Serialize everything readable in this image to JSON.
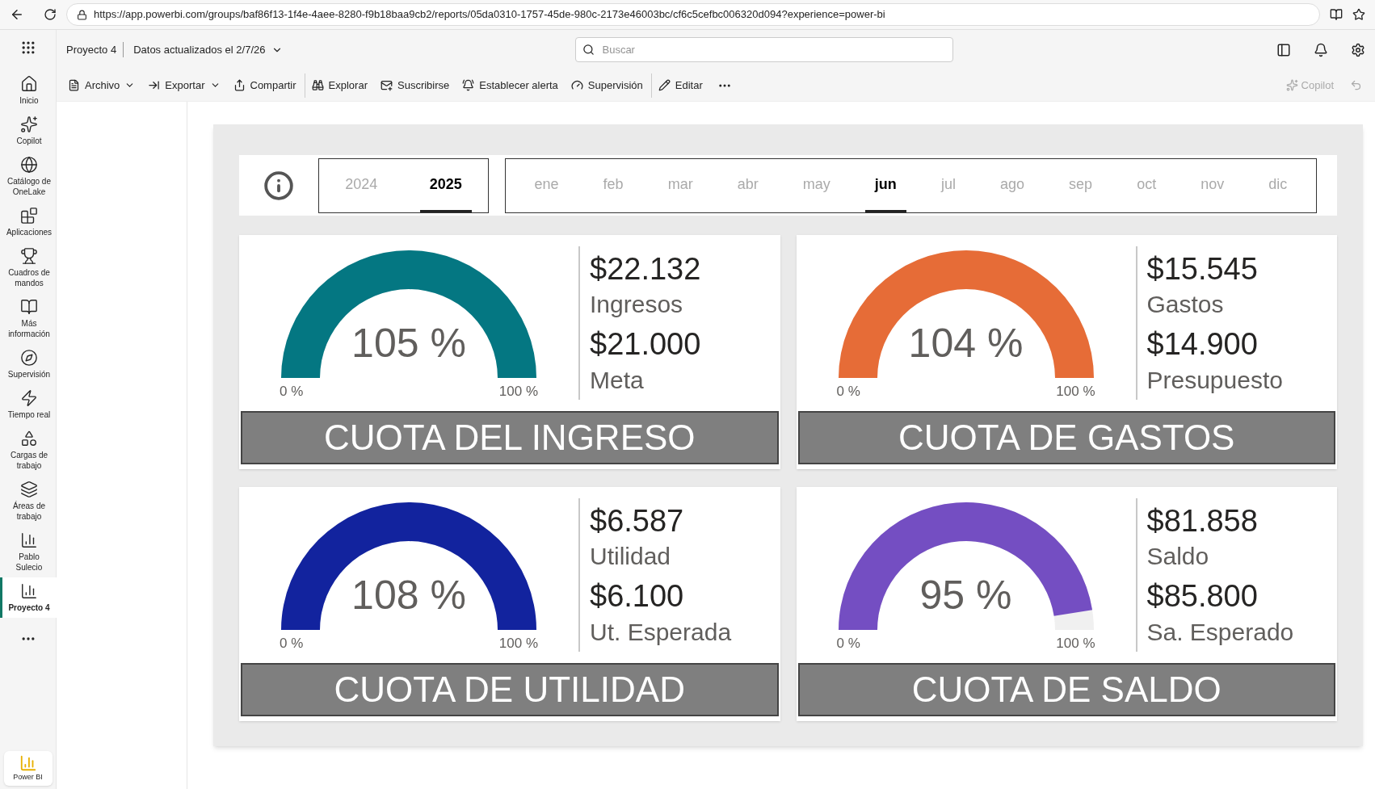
{
  "browser": {
    "url": "https://app.powerbi.com/groups/baf86f13-1f4e-4aee-8280-f9b18baa9cb2/reports/05da0310-1757-45de-980c-2173e46003bc/cf6c5cefbc006320d094?experience=power-bi"
  },
  "header": {
    "workspace": "Proyecto 4",
    "updated": "Datos actualizados el 2/7/26",
    "search": {
      "placeholder": "Buscar"
    }
  },
  "toolbar": [
    {
      "label": "Archivo",
      "dropdown": true
    },
    {
      "label": "Exportar",
      "dropdown": true
    },
    {
      "label": "Compartir",
      "dropdown": false
    },
    {
      "label": "Explorar",
      "dropdown": false
    },
    {
      "label": "Suscribirse",
      "dropdown": false
    },
    {
      "label": "Establecer alerta",
      "dropdown": false
    },
    {
      "label": "Supervisión",
      "dropdown": false
    },
    {
      "label": "Editar",
      "dropdown": false
    }
  ],
  "copilot": {
    "label": "Copilot",
    "disabled": true
  },
  "sidebar": {
    "items": [
      {
        "label": "Inicio",
        "selected": false
      },
      {
        "label": "Copilot",
        "selected": false
      },
      {
        "label": "Catálogo de OneLake",
        "selected": false
      },
      {
        "label": "Aplicaciones",
        "selected": false
      },
      {
        "label": "Cuadros de mandos",
        "selected": false
      },
      {
        "label": "Más información",
        "selected": false
      },
      {
        "label": "Supervisión",
        "selected": false
      },
      {
        "label": "Tiempo real",
        "selected": false
      },
      {
        "label": "Cargas de trabajo",
        "selected": false
      },
      {
        "label": "Áreas de trabajo",
        "selected": false
      },
      {
        "label": "Pablo Sulecio",
        "selected": false
      },
      {
        "label": "Proyecto 4",
        "selected": true
      }
    ],
    "app": "Power BI"
  },
  "filters": {
    "years": [
      {
        "label": "2024",
        "selected": false
      },
      {
        "label": "2025",
        "selected": true
      }
    ],
    "months": [
      {
        "label": "ene",
        "selected": false
      },
      {
        "label": "feb",
        "selected": false
      },
      {
        "label": "mar",
        "selected": false
      },
      {
        "label": "abr",
        "selected": false
      },
      {
        "label": "may",
        "selected": false
      },
      {
        "label": "jun",
        "selected": true
      },
      {
        "label": "jul",
        "selected": false
      },
      {
        "label": "ago",
        "selected": false
      },
      {
        "label": "sep",
        "selected": false
      },
      {
        "label": "oct",
        "selected": false
      },
      {
        "label": "nov",
        "selected": false
      },
      {
        "label": "dic",
        "selected": false
      }
    ]
  },
  "cards": [
    {
      "percent": "105 %",
      "level": 1,
      "color": "#047782",
      "min": "0 %",
      "max": "100 %",
      "value": "$22.132",
      "value_label": "Ingresos",
      "target": "$21.000",
      "target_label": "Meta",
      "title": "CUOTA DEL INGRESO"
    },
    {
      "percent": "104 %",
      "level": 1,
      "color": "#e66c37",
      "min": "0 %",
      "max": "100 %",
      "value": "$15.545",
      "value_label": "Gastos",
      "target": "$14.900",
      "target_label": "Presupuesto",
      "title": "CUOTA DE GASTOS"
    },
    {
      "percent": "108 %",
      "level": 1,
      "color": "#12239e",
      "min": "0 %",
      "max": "100 %",
      "value": "$6.587",
      "value_label": "Utilidad",
      "target": "$6.100",
      "target_label": "Ut. Esperada",
      "title": "CUOTA DE UTILIDAD"
    },
    {
      "percent": "95 %",
      "level": 0.95,
      "color": "#744ec2",
      "min": "0 %",
      "max": "100 %",
      "value": "$81.858",
      "value_label": "Saldo",
      "target": "$85.800",
      "target_label": "Sa. Esperado",
      "title": "CUOTA DE SALDO"
    }
  ]
}
